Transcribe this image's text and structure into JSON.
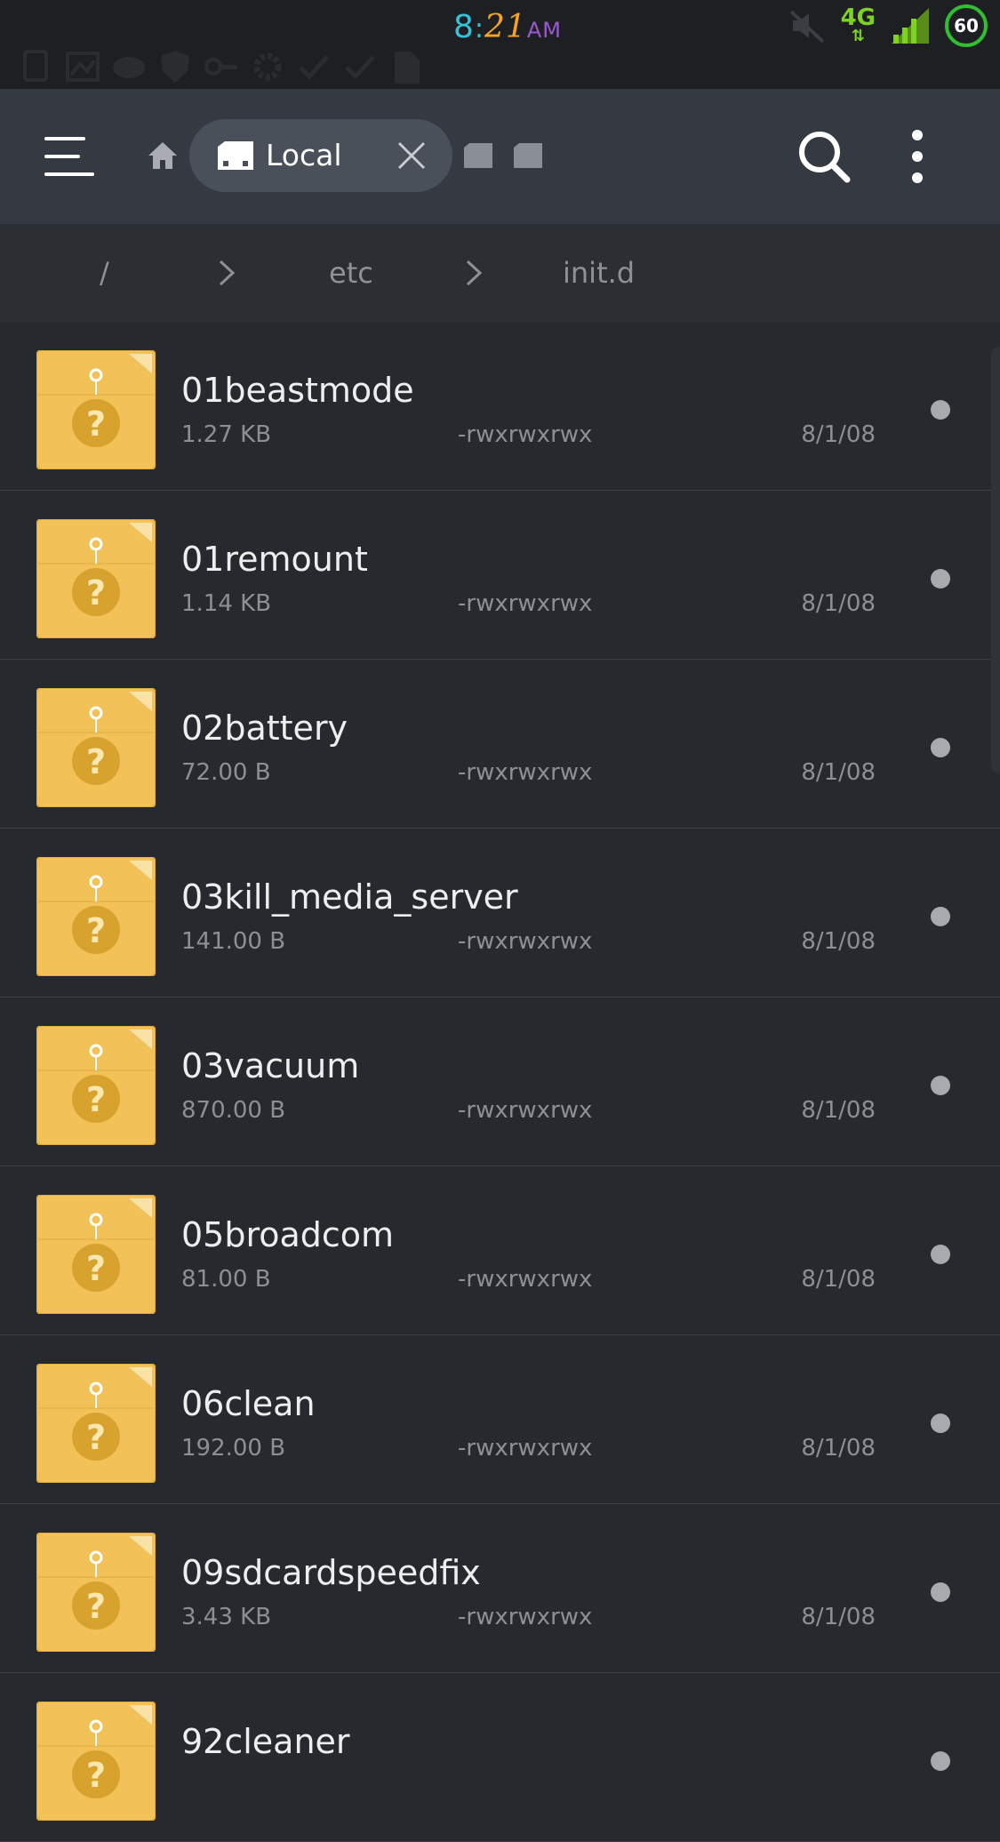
{
  "status_bar": {
    "time_hour": "8",
    "time_minutes": "21",
    "time_ampm": "AM",
    "network": "4G",
    "battery_level": "60",
    "colors": {
      "clock_hour": "#35c3d9",
      "clock_minutes": "#f4a623",
      "clock_ampm": "#9b59d0",
      "network": "#7ed321",
      "battery_ring": "#2fbf2f"
    },
    "notification_icons": [
      "notification-icon-1",
      "notification-icon-2",
      "notification-icon-3",
      "shield-icon",
      "key-icon",
      "gear-icon",
      "check-icon",
      "check-icon",
      "file-icon"
    ]
  },
  "toolbar": {
    "menu_icon": "hamburger-menu-icon",
    "home_icon": "home-icon",
    "active_tab_label": "Local",
    "active_tab_icon": "storage-icon",
    "close_icon": "close-icon",
    "extra_tabs": [
      "sdcard-icon",
      "sdcard-icon"
    ],
    "search_icon": "search-icon",
    "more_icon": "more-vertical-icon"
  },
  "breadcrumb": {
    "items": [
      "/",
      "etc",
      "init.d"
    ],
    "separator_icon": "chevron-right-icon"
  },
  "files": [
    {
      "name": "01beastmode",
      "size": "1.27 KB",
      "permissions": "-rwxrwxrwx",
      "date": "8/1/08"
    },
    {
      "name": "01remount",
      "size": "1.14 KB",
      "permissions": "-rwxrwxrwx",
      "date": "8/1/08"
    },
    {
      "name": "02battery",
      "size": "72.00 B",
      "permissions": "-rwxrwxrwx",
      "date": "8/1/08"
    },
    {
      "name": "03kill_media_server",
      "size": "141.00 B",
      "permissions": "-rwxrwxrwx",
      "date": "8/1/08"
    },
    {
      "name": "03vacuum",
      "size": "870.00 B",
      "permissions": "-rwxrwxrwx",
      "date": "8/1/08"
    },
    {
      "name": "05broadcom",
      "size": "81.00 B",
      "permissions": "-rwxrwxrwx",
      "date": "8/1/08"
    },
    {
      "name": "06clean",
      "size": "192.00 B",
      "permissions": "-rwxrwxrwx",
      "date": "8/1/08"
    },
    {
      "name": "09sdcardspeedfix",
      "size": "3.43 KB",
      "permissions": "-rwxrwxrwx",
      "date": "8/1/08"
    },
    {
      "name": "92cleaner",
      "size": "",
      "permissions": "",
      "date": ""
    }
  ],
  "file_icon": "unknown-file-folder-icon",
  "row_indicator_icon": "dot-indicator-icon"
}
